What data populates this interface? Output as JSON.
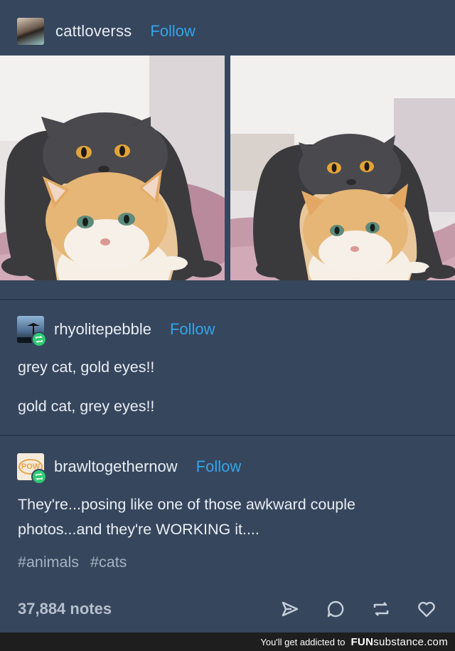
{
  "post": {
    "author": "cattloverss",
    "follow_label": "Follow",
    "images": [
      "two-cats-stacked-photo",
      "two-cats-stacked-photo-zoom"
    ]
  },
  "reblogs": [
    {
      "author": "rhyolitepebble",
      "follow_label": "Follow",
      "paragraphs": [
        "grey cat, gold eyes!!",
        "gold cat, grey eyes!!"
      ]
    },
    {
      "author": "brawltogethernow",
      "follow_label": "Follow",
      "avatar_text": "POW",
      "paragraphs": [
        "They're...posing like one of those awkward couple photos...and they're WORKING it...."
      ]
    }
  ],
  "tags": [
    "#animals",
    "#cats"
  ],
  "notes_label": "37,884 notes",
  "actions": [
    "share-icon",
    "reply-icon",
    "reblog-icon",
    "like-icon"
  ],
  "banner": {
    "text": "You'll get addicted to",
    "brand_bold": "FUN",
    "brand_light": "substance.com"
  },
  "colors": {
    "background": "#36465d",
    "follow": "#33a4e9",
    "reblog_badge": "#2ecb71",
    "banner_bg": "#1e1e1e"
  }
}
